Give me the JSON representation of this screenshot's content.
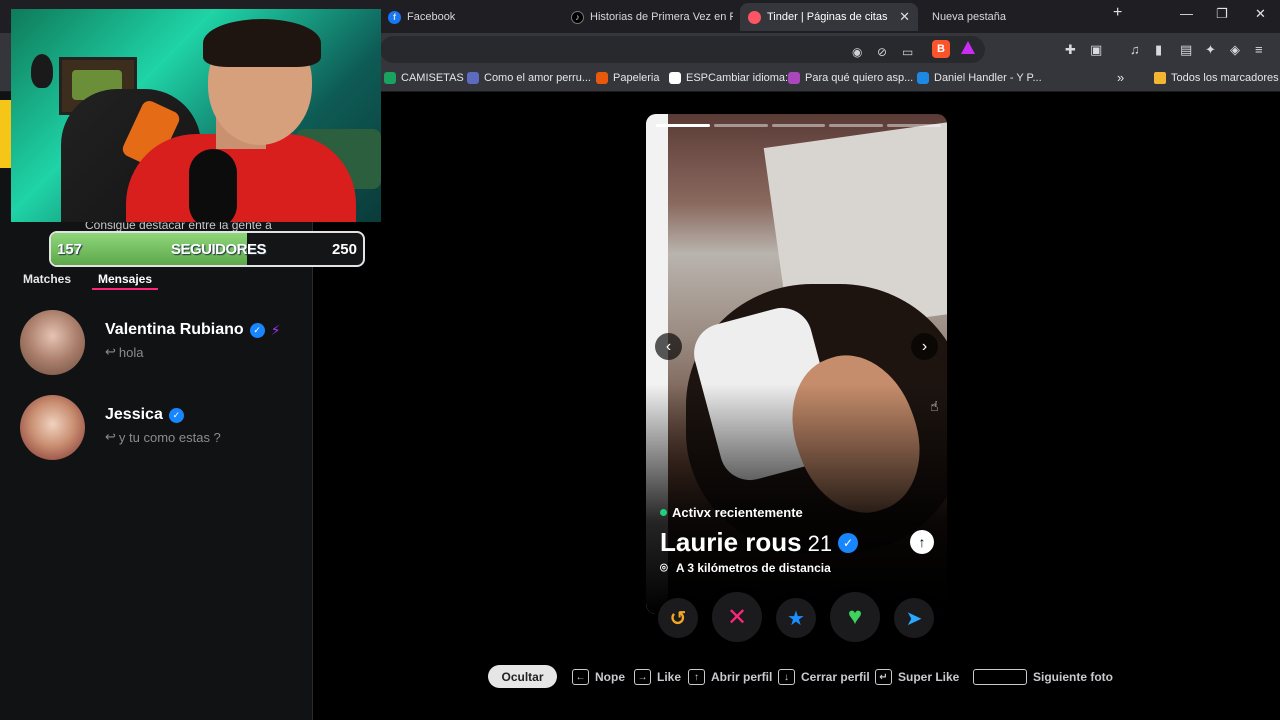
{
  "browser": {
    "tabs": [
      {
        "label": "Facebook",
        "favicon": "facebook-icon",
        "color": "#1877f2"
      },
      {
        "label": "Historias de Primera Vez en Red",
        "favicon": "tiktok-icon",
        "color": "#000000"
      },
      {
        "label": "Tinder | Páginas de citas",
        "favicon": "tinder-flame-icon",
        "color": "#fd5564",
        "active": true
      },
      {
        "label": "Nueva pestaña",
        "favicon": "",
        "color": ""
      }
    ],
    "new_tab": "+",
    "bookmarks": [
      {
        "label": "CAMISETAS",
        "color": "#1aa260"
      },
      {
        "label": "Como el amor perru...",
        "color": "#5c6bc0"
      },
      {
        "label": "Papeleria",
        "color": "#e8590c"
      },
      {
        "label": "ESPCambiar idioma:",
        "color": "#ffffff"
      },
      {
        "label": "Para qué quiero asp...",
        "color": "#ab47bc"
      },
      {
        "label": "Daniel Handler - Y P...",
        "color": "#1e88e5"
      }
    ],
    "bookmarks_more": "»",
    "all_bookmarks": "Todos los marcadores"
  },
  "stream": {
    "followers_current": "157",
    "followers_label": "SEGUIDORES",
    "followers_goal": "250",
    "followers_progress": 0.628
  },
  "sidebar": {
    "promo_text": "Consigue destacar entre la gente a",
    "tabs": [
      {
        "label": "Matches"
      },
      {
        "label": "Mensajes",
        "selected": true
      }
    ],
    "conversations": [
      {
        "name": "Valentina Rubiano",
        "verified": true,
        "boost": true,
        "last_message": "hola",
        "reply_arrow": "↩"
      },
      {
        "name": "Jessica",
        "verified": true,
        "boost": false,
        "last_message": "y tu como estas ?",
        "reply_arrow": "↩"
      }
    ]
  },
  "profile": {
    "active_status": "Activx recientemente",
    "name": "Laurie rous",
    "age": "21",
    "verified": true,
    "distance": "A 3 kilómetros de distancia",
    "photo_count": 5,
    "current_photo": 1
  },
  "actions": [
    {
      "name": "rewind-button",
      "icon": "↺",
      "color": "#f5a623"
    },
    {
      "name": "nope-button",
      "icon": "✕",
      "color": "#fd267a"
    },
    {
      "name": "super-like-button",
      "icon": "★",
      "color": "#1b8fff"
    },
    {
      "name": "like-button",
      "icon": "♥",
      "color": "#3fd25e"
    },
    {
      "name": "boost-button",
      "icon": "➤",
      "color": "#2aa7ff"
    }
  ],
  "shortcuts": {
    "hide": "Ocultar",
    "items": [
      {
        "key": "←",
        "label": "Nope"
      },
      {
        "key": "→",
        "label": "Like"
      },
      {
        "key": "↑",
        "label": "Abrir perfil"
      },
      {
        "key": "↓",
        "label": "Cerrar perfil"
      },
      {
        "key": "↵",
        "label": "Super Like"
      },
      {
        "key": "",
        "label": "Siguiente foto"
      }
    ]
  }
}
